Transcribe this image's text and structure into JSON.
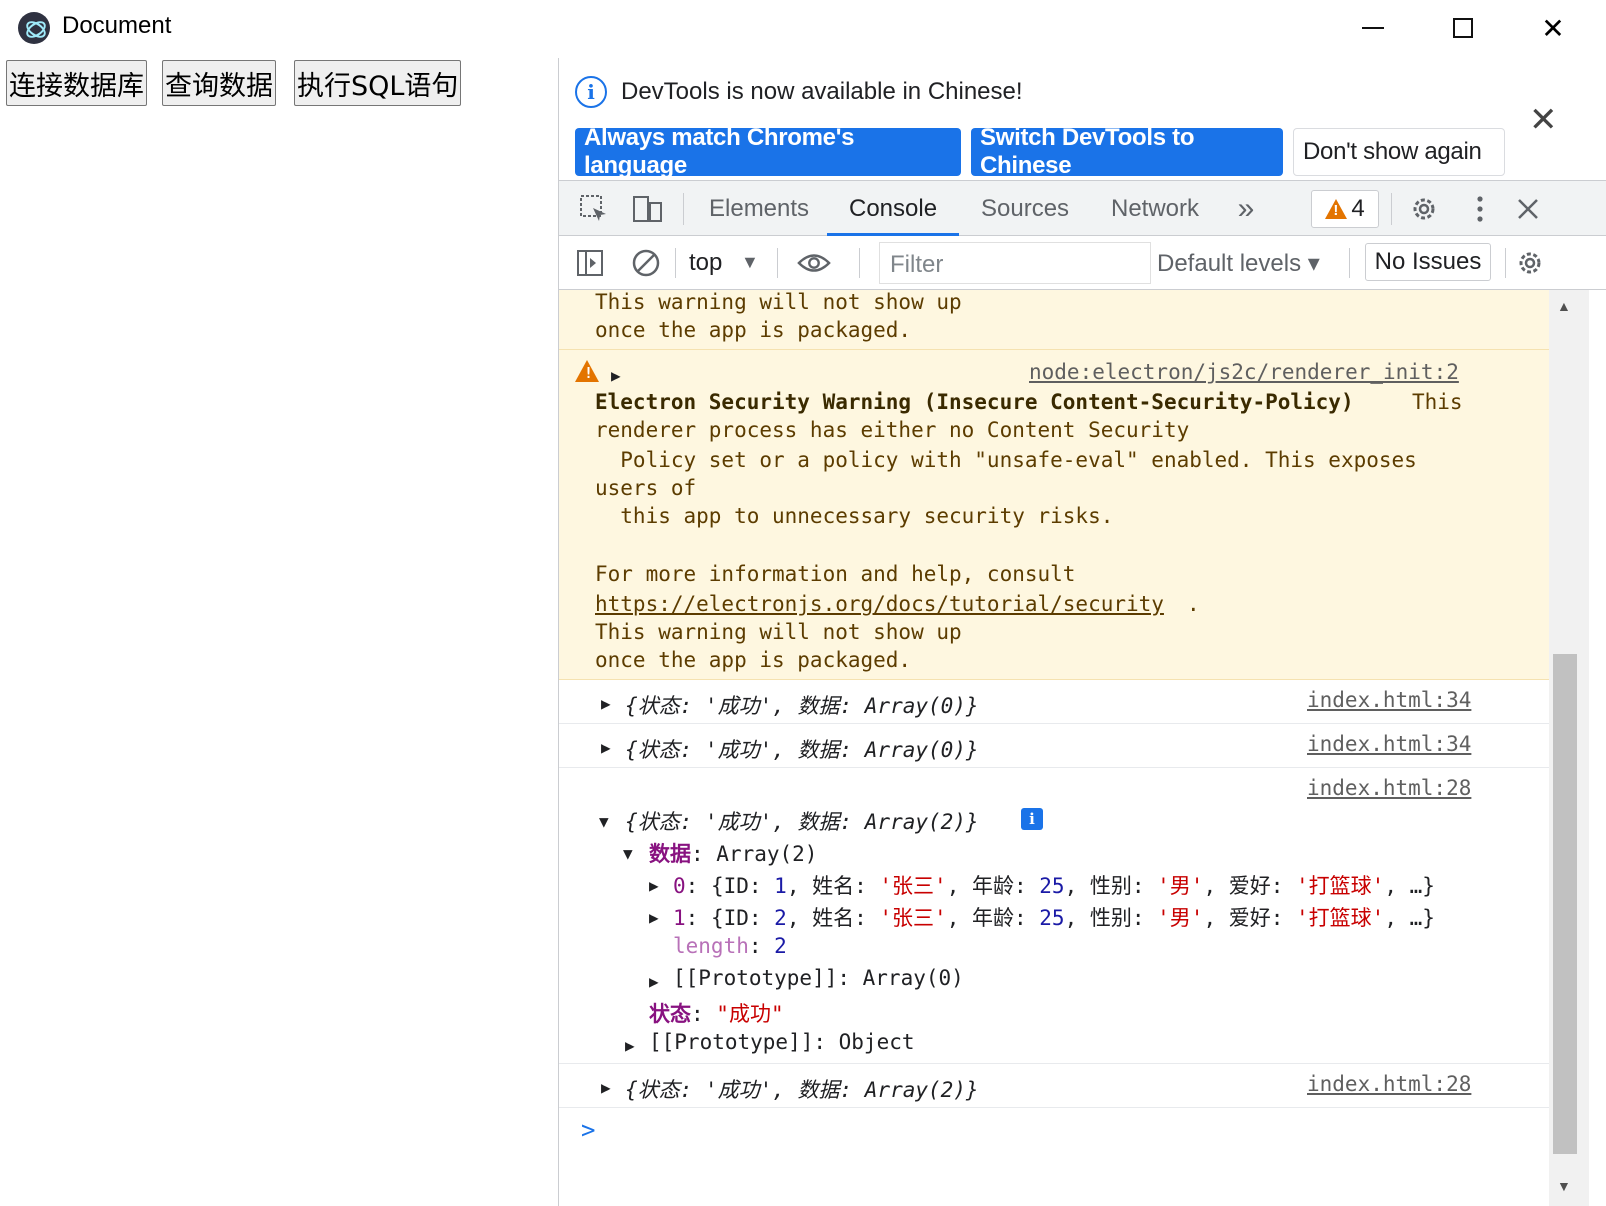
{
  "window": {
    "title": "Document",
    "controls": {
      "minimize": "minimize",
      "maximize": "maximize",
      "close": "✕"
    }
  },
  "app": {
    "buttons": [
      "连接数据库",
      "查询数据",
      "执行SQL语句"
    ]
  },
  "devtools": {
    "infobar": {
      "message": "DevTools is now available in Chinese!",
      "buttons": [
        "Always match Chrome's language",
        "Switch DevTools to Chinese",
        "Don't show again"
      ],
      "close": "✕"
    },
    "tabs": [
      "Elements",
      "Console",
      "Sources",
      "Network"
    ],
    "active_tab": "Console",
    "more_tabs": "»",
    "warning_count": "4",
    "toolbar": {
      "context": "top",
      "filter_placeholder": "Filter",
      "levels": "Default levels ▾",
      "issues": "No Issues"
    },
    "console": {
      "warn_tail": [
        "This warning will not show up",
        "once the app is packaged."
      ],
      "warning": {
        "source": "node:electron/js2c/renderer_init:2",
        "title": "Electron Security Warning (Insecure Content-Security-Policy)",
        "lines": [
          "This",
          "renderer process has either no Content Security",
          "  Policy set or a policy with \"unsafe-eval\" enabled. This exposes",
          "users of",
          "  this app to unnecessary security risks.",
          "For more information and help, consult",
          "https://electronjs.org/docs/tutorial/security",
          ".",
          "This warning will not show up",
          "once the app is packaged."
        ]
      },
      "logs": [
        {
          "text": "{状态: '成功', 数据: Array(0)}",
          "source": "index.html:34"
        },
        {
          "text": "{状态: '成功', 数据: Array(0)}",
          "source": "index.html:34"
        },
        {
          "text": "{状态: '成功', 数据: Array(2)}",
          "source": "index.html:28"
        },
        {
          "text": "{状态: '成功', 数据: Array(2)}",
          "source": "index.html:28"
        }
      ],
      "expanded": {
        "data_key": "数据",
        "data_val": "Array(2)",
        "items": [
          {
            "idx": "0",
            "id": "1",
            "name": "'张三'",
            "age": "25",
            "gender": "'男'",
            "hobby": "'打篮球'"
          },
          {
            "idx": "1",
            "id": "2",
            "name": "'张三'",
            "age": "25",
            "gender": "'男'",
            "hobby": "'打篮球'"
          }
        ],
        "length_key": "length",
        "length_val": "2",
        "proto_array": "[[Prototype]]: Array(0)",
        "status_key": "状态",
        "status_val": "\"成功\"",
        "proto_object": "[[Prototype]]: Object"
      },
      "prompt": ">"
    }
  }
}
